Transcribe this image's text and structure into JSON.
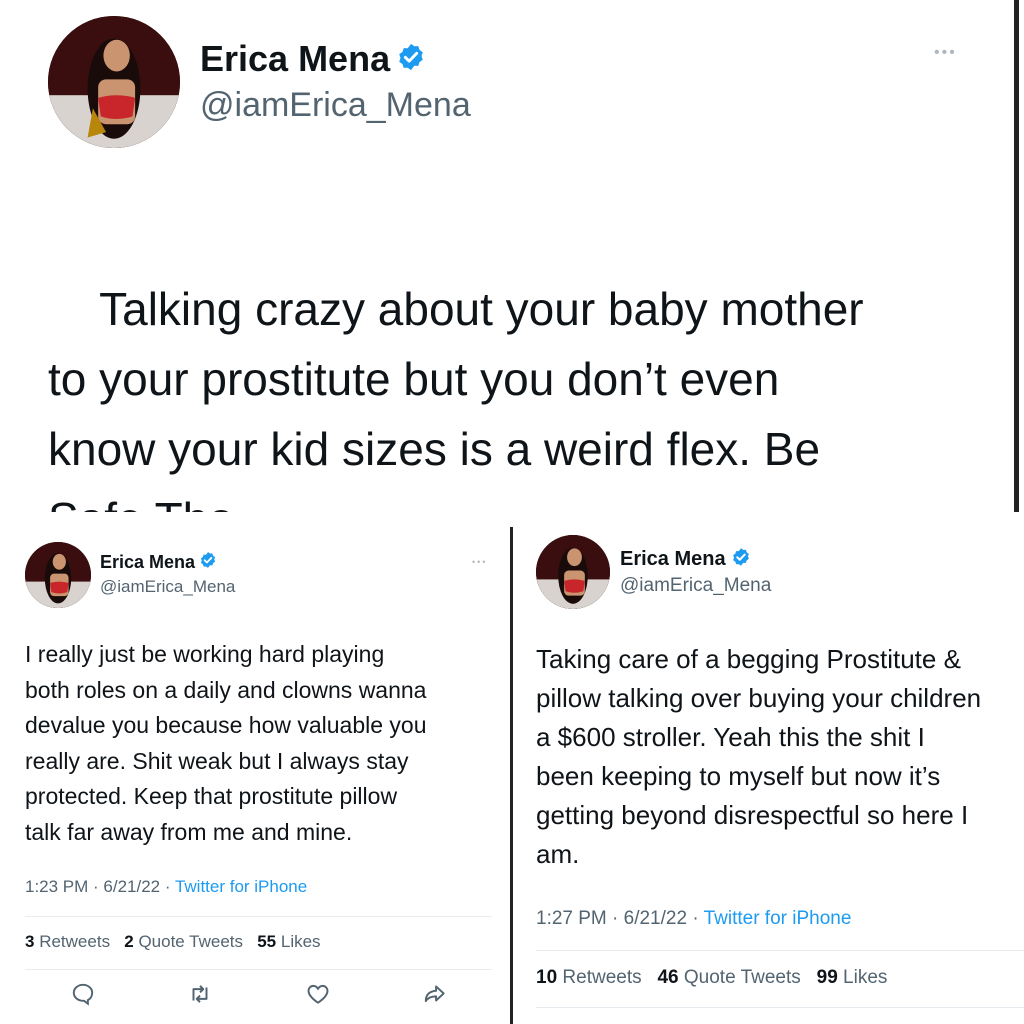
{
  "top": {
    "name": "Erica Mena",
    "handle": "@iamErica_Mena",
    "more": "•••",
    "text": "Talking crazy about your baby mother\nto your prostitute but you don’t even\nknow your kid sizes is a weird flex. Be\nSafe Tho",
    "emojis": [
      "laughing-tears-icon",
      "raised-hands-icon"
    ]
  },
  "left": {
    "name": "Erica Mena",
    "handle": "@iamErica_Mena",
    "more": "•••",
    "text": "I really just be working hard playing\nboth roles on a daily and clowns wanna\ndevalue you because how valuable you\nreally are. Shit weak but I always stay\nprotected. Keep that prostitute pillow\ntalk far away from me and mine.",
    "time": "1:23 PM · 6/21/22 · ",
    "source": "Twitter for iPhone",
    "retweets_count": "3",
    "retweets_label": "Retweets",
    "quotes_count": "2",
    "quotes_label": "Quote Tweets",
    "likes_count": "55",
    "likes_label": "Likes"
  },
  "right": {
    "name": "Erica Mena",
    "handle": "@iamErica_Mena",
    "text": "Taking care of a begging Prostitute &\npillow talking over buying your children\na $600 stroller. Yeah this the shit I\nbeen keeping to myself but now it’s\ngetting beyond disrespectful so here I\nam.",
    "time": "1:27 PM · 6/21/22 · ",
    "source": "Twitter for iPhone",
    "retweets_count": "10",
    "retweets_label": "Retweets",
    "quotes_count": "46",
    "quotes_label": "Quote Tweets",
    "likes_count": "99",
    "likes_label": "Likes"
  },
  "colors": {
    "verified": "#1d9bf0",
    "link": "#1d9bf0",
    "secondary_text": "#536471",
    "primary_text": "#0f1419"
  }
}
